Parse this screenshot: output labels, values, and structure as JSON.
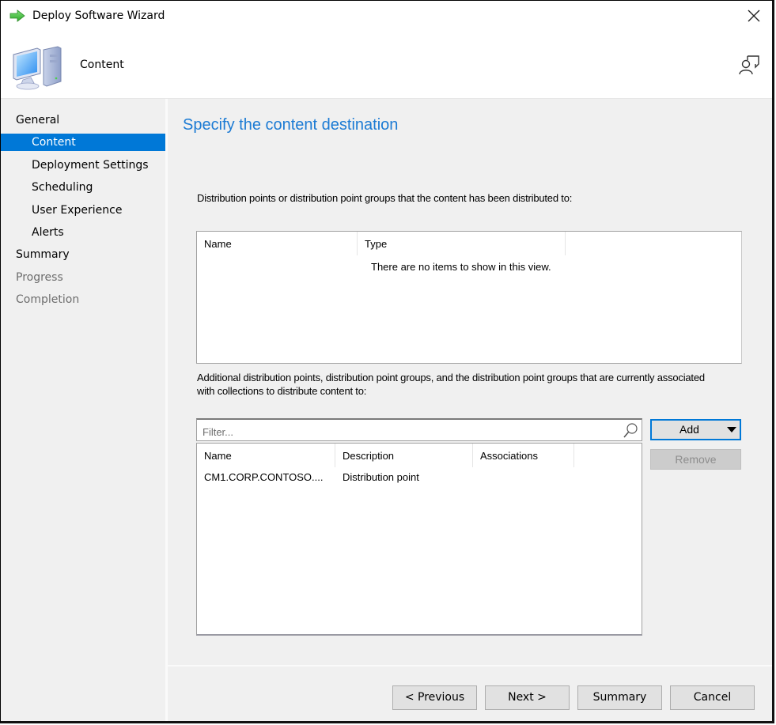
{
  "window": {
    "title": "Deploy Software Wizard",
    "title_icon": "green-arrow-icon",
    "close_icon": "close-icon"
  },
  "header": {
    "title": "Content",
    "icon": "computer-icon",
    "help_icon": "user-feedback-icon"
  },
  "sidebar": {
    "items": [
      {
        "label": "General",
        "level": 1,
        "state": "normal"
      },
      {
        "label": "Content",
        "level": 2,
        "state": "active"
      },
      {
        "label": "Deployment Settings",
        "level": 2,
        "state": "normal"
      },
      {
        "label": "Scheduling",
        "level": 2,
        "state": "normal"
      },
      {
        "label": "User Experience",
        "level": 2,
        "state": "normal"
      },
      {
        "label": "Alerts",
        "level": 2,
        "state": "normal"
      },
      {
        "label": "Summary",
        "level": 1,
        "state": "normal"
      },
      {
        "label": "Progress",
        "level": 1,
        "state": "disabled"
      },
      {
        "label": "Completion",
        "level": 1,
        "state": "disabled"
      }
    ]
  },
  "main": {
    "heading": "Specify the content destination",
    "distributed_label": "Distribution points or distribution point groups that the content has been distributed to:",
    "distributed_list": {
      "columns": [
        "Name",
        "Type"
      ],
      "empty_message": "There are no items to show in this view."
    },
    "additional_label": "Additional distribution points, distribution point groups, and the distribution point groups that are currently associated with collections to distribute content to:",
    "filter": {
      "placeholder": "Filter...",
      "value": ""
    },
    "additional_list": {
      "columns": [
        "Name",
        "Description",
        "Associations"
      ],
      "rows": [
        {
          "name": "CM1.CORP.CONTOSO....",
          "description": "Distribution point",
          "associations": ""
        }
      ]
    },
    "add_button": "Add",
    "remove_button": "Remove"
  },
  "footer": {
    "previous": "< Previous",
    "next": "Next >",
    "summary": "Summary",
    "cancel": "Cancel"
  },
  "colors": {
    "accent": "#0078d7",
    "heading": "#1c7bd4",
    "panel": "#f0f0f0",
    "disabled_text": "#6d6d6d"
  }
}
